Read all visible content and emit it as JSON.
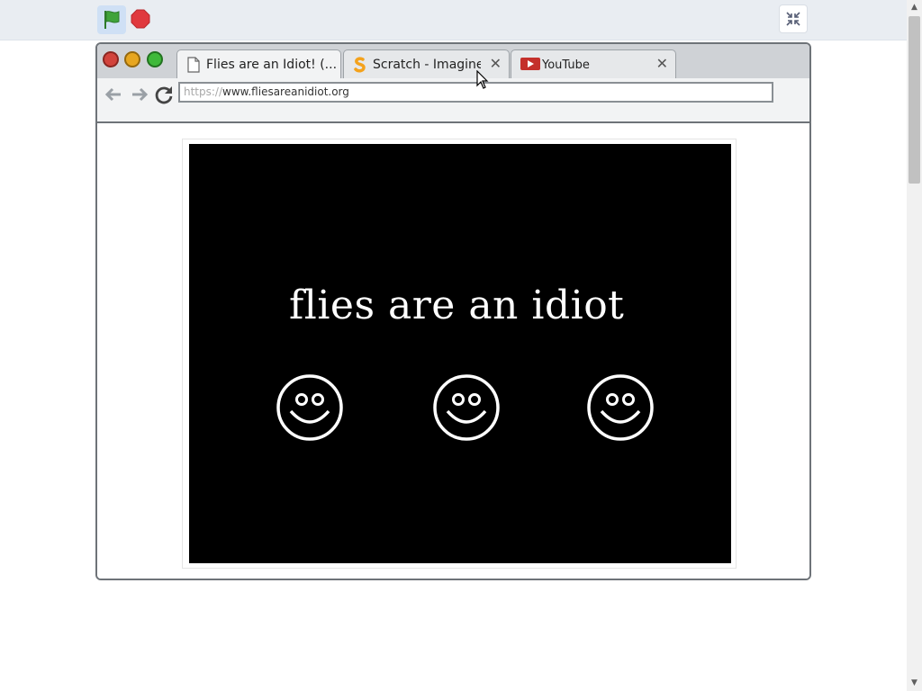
{
  "scratch": {
    "green_flag_icon": "green-flag-icon",
    "stop_icon": "stop-icon",
    "fullscreen_icon": "exit-fullscreen-icon"
  },
  "browser": {
    "tabs": [
      {
        "label": "Flies are an Idiot! (...",
        "icon": "page-icon",
        "close": ""
      },
      {
        "label": "Scratch - Imagine",
        "icon": "scratch-icon",
        "close": "✕"
      },
      {
        "label": "YouTube",
        "icon": "youtube-icon",
        "close": "✕"
      }
    ],
    "address": {
      "protocol": "https://",
      "host": "www.fliesareanidiot.org"
    }
  },
  "page": {
    "headline": "flies are an idiot",
    "smiley_count": 3
  },
  "colors": {
    "stage_bg": "#000000",
    "text": "#ffffff",
    "flag": "#3fa33a",
    "stop": "#e0393e"
  }
}
